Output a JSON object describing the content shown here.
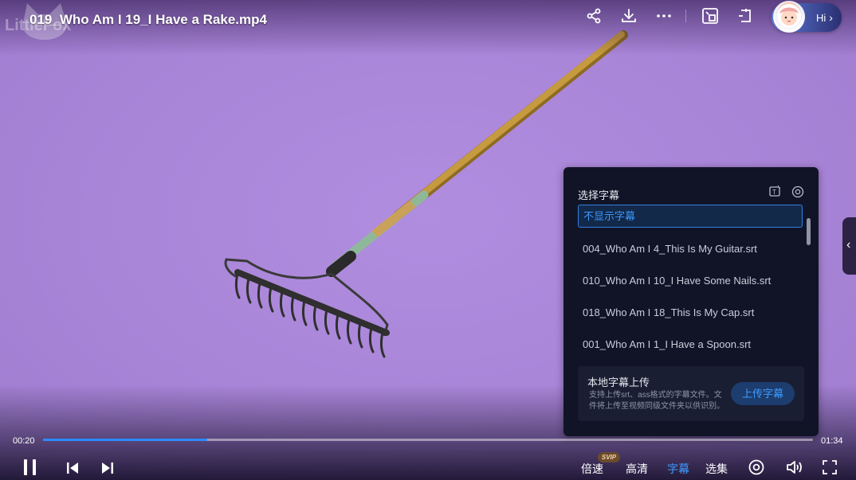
{
  "video": {
    "title": "019_Who Am I 19_I Have a Rake.mp4",
    "logo_text": "LittleFox"
  },
  "top_bar": {
    "icons": [
      "share-icon",
      "download-icon",
      "more-icon",
      "picture-in-picture-icon",
      "pin-window-icon"
    ],
    "hi_label": "Hi"
  },
  "subtitle_panel": {
    "title": "选择字幕",
    "selected": "不显示字幕",
    "options": [
      "004_Who Am I 4_This Is My Guitar.srt",
      "010_Who Am I 10_I Have Some Nails.srt",
      "018_Who Am I 18_This Is My Cap.srt",
      "001_Who Am I 1_I Have a Spoon.srt"
    ],
    "upload_title": "本地字幕上传",
    "upload_desc": "支持上传srt、ass格式的字幕文件。文件将上传至视频同级文件夹以供识别。",
    "upload_button": "上传字幕"
  },
  "player": {
    "current_time": "00:20",
    "total_time": "01:34",
    "progress": 0.213,
    "speed_label": "倍速",
    "speed_badge": "SVIP",
    "quality_label": "高清",
    "subtitle_label": "字幕",
    "episodes_label": "选集"
  },
  "colors": {
    "accent": "#3f9bff",
    "background": "#a987da",
    "panel": "#111427"
  }
}
